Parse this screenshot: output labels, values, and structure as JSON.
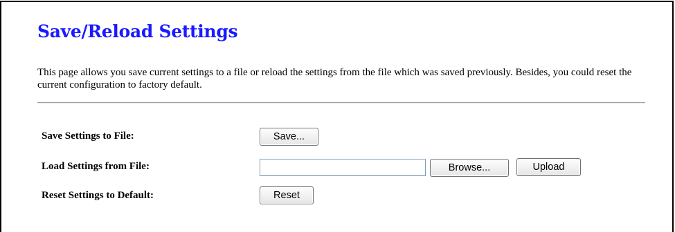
{
  "page": {
    "title": "Save/Reload Settings",
    "description": "This page allows you save current settings to a file or reload the settings from the file which was saved previously. Besides, you could reset the current configuration to factory default."
  },
  "save": {
    "label": "Save Settings to File:",
    "button": "Save..."
  },
  "load": {
    "label": "Load Settings from File:",
    "file_value": "",
    "browse_button": "Browse...",
    "upload_button": "Upload"
  },
  "reset": {
    "label": "Reset Settings to Default:",
    "button": "Reset"
  },
  "colors": {
    "title": "#1a1aff",
    "divider": "#a0a0a0",
    "input_border": "#7f9db9"
  }
}
